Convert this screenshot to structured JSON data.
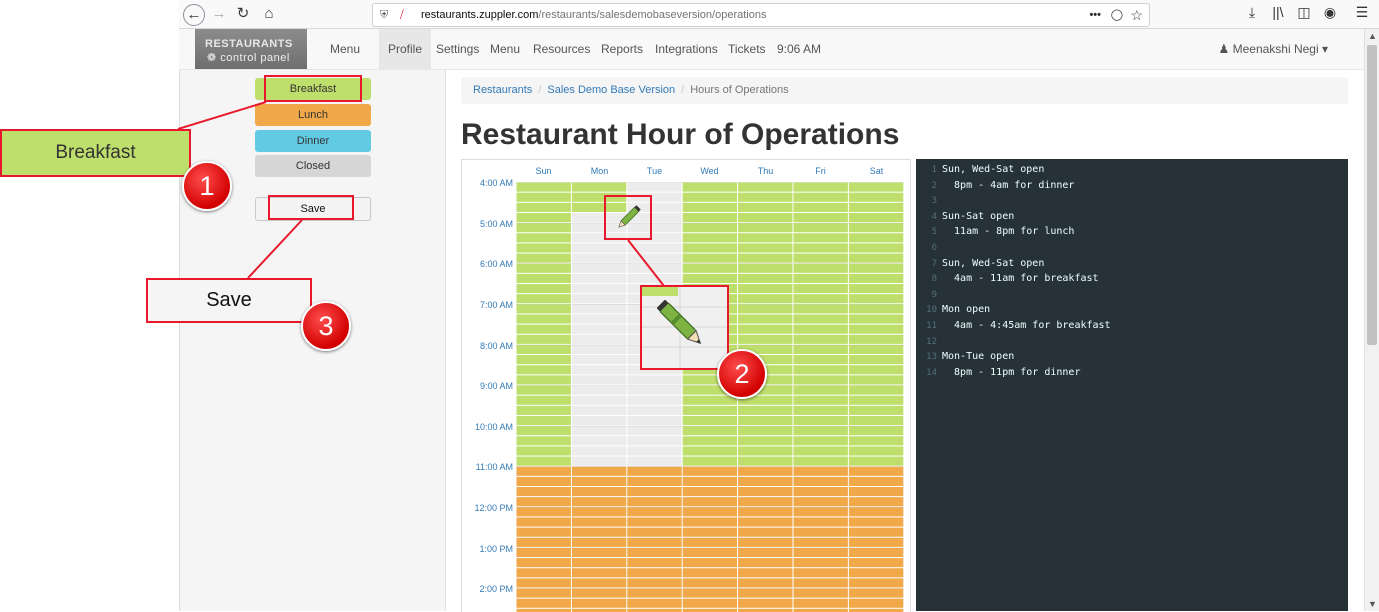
{
  "browser": {
    "url_domain": "restaurants.zuppler.com",
    "url_path": "/restaurants/salesdemobaseversion/operations",
    "more_icon": "meatball-menu-icon"
  },
  "app_nav": {
    "brand_line1": "RESTAURANTS",
    "brand_line2": "control panel",
    "links": [
      "Menu",
      "Profile",
      "Settings",
      "Menu",
      "Resources",
      "Reports",
      "Integrations",
      "Tickets"
    ],
    "clock": "9:06 AM",
    "user": "Meenakshi Negi"
  },
  "sidebar": {
    "breakfast": "Breakfast",
    "lunch": "Lunch",
    "dinner": "Dinner",
    "closed": "Closed",
    "save": "Save"
  },
  "breadcrumb": {
    "item1": "Restaurants",
    "item2": "Sales Demo Base Version",
    "current": "Hours of Operations"
  },
  "page_title": "Restaurant Hour of Operations",
  "schedule": {
    "days": [
      "Sun",
      "Mon",
      "Tue",
      "Wed",
      "Thu",
      "Fri",
      "Sat"
    ],
    "time_labels": [
      "4:00 AM",
      "5:00 AM",
      "6:00 AM",
      "7:00 AM",
      "8:00 AM",
      "9:00 AM",
      "10:00 AM",
      "11:00 AM",
      "12:00 PM",
      "1:00 PM",
      "2:00 PM"
    ],
    "colors": {
      "breakfast": "#bedf6c",
      "lunch": "#f0a848",
      "dinner": "#62cbe3",
      "closed": "#ececec"
    }
  },
  "code_editor": {
    "lines": [
      "Sun, Wed-Sat open",
      "  8pm - 4am for dinner",
      "",
      "Sun-Sat open",
      "  11am - 8pm for lunch",
      "",
      "Sun, Wed-Sat open",
      "  4am - 11am for breakfast",
      "",
      "Mon open",
      "  4am - 4:45am for breakfast",
      "",
      "Mon-Tue open",
      "  8pm - 11pm for dinner"
    ]
  },
  "annotations": {
    "callout_breakfast": "Breakfast",
    "callout_save": "Save",
    "badge1": "1",
    "badge2": "2",
    "badge3": "3",
    "accent_color": "#e8192c"
  }
}
